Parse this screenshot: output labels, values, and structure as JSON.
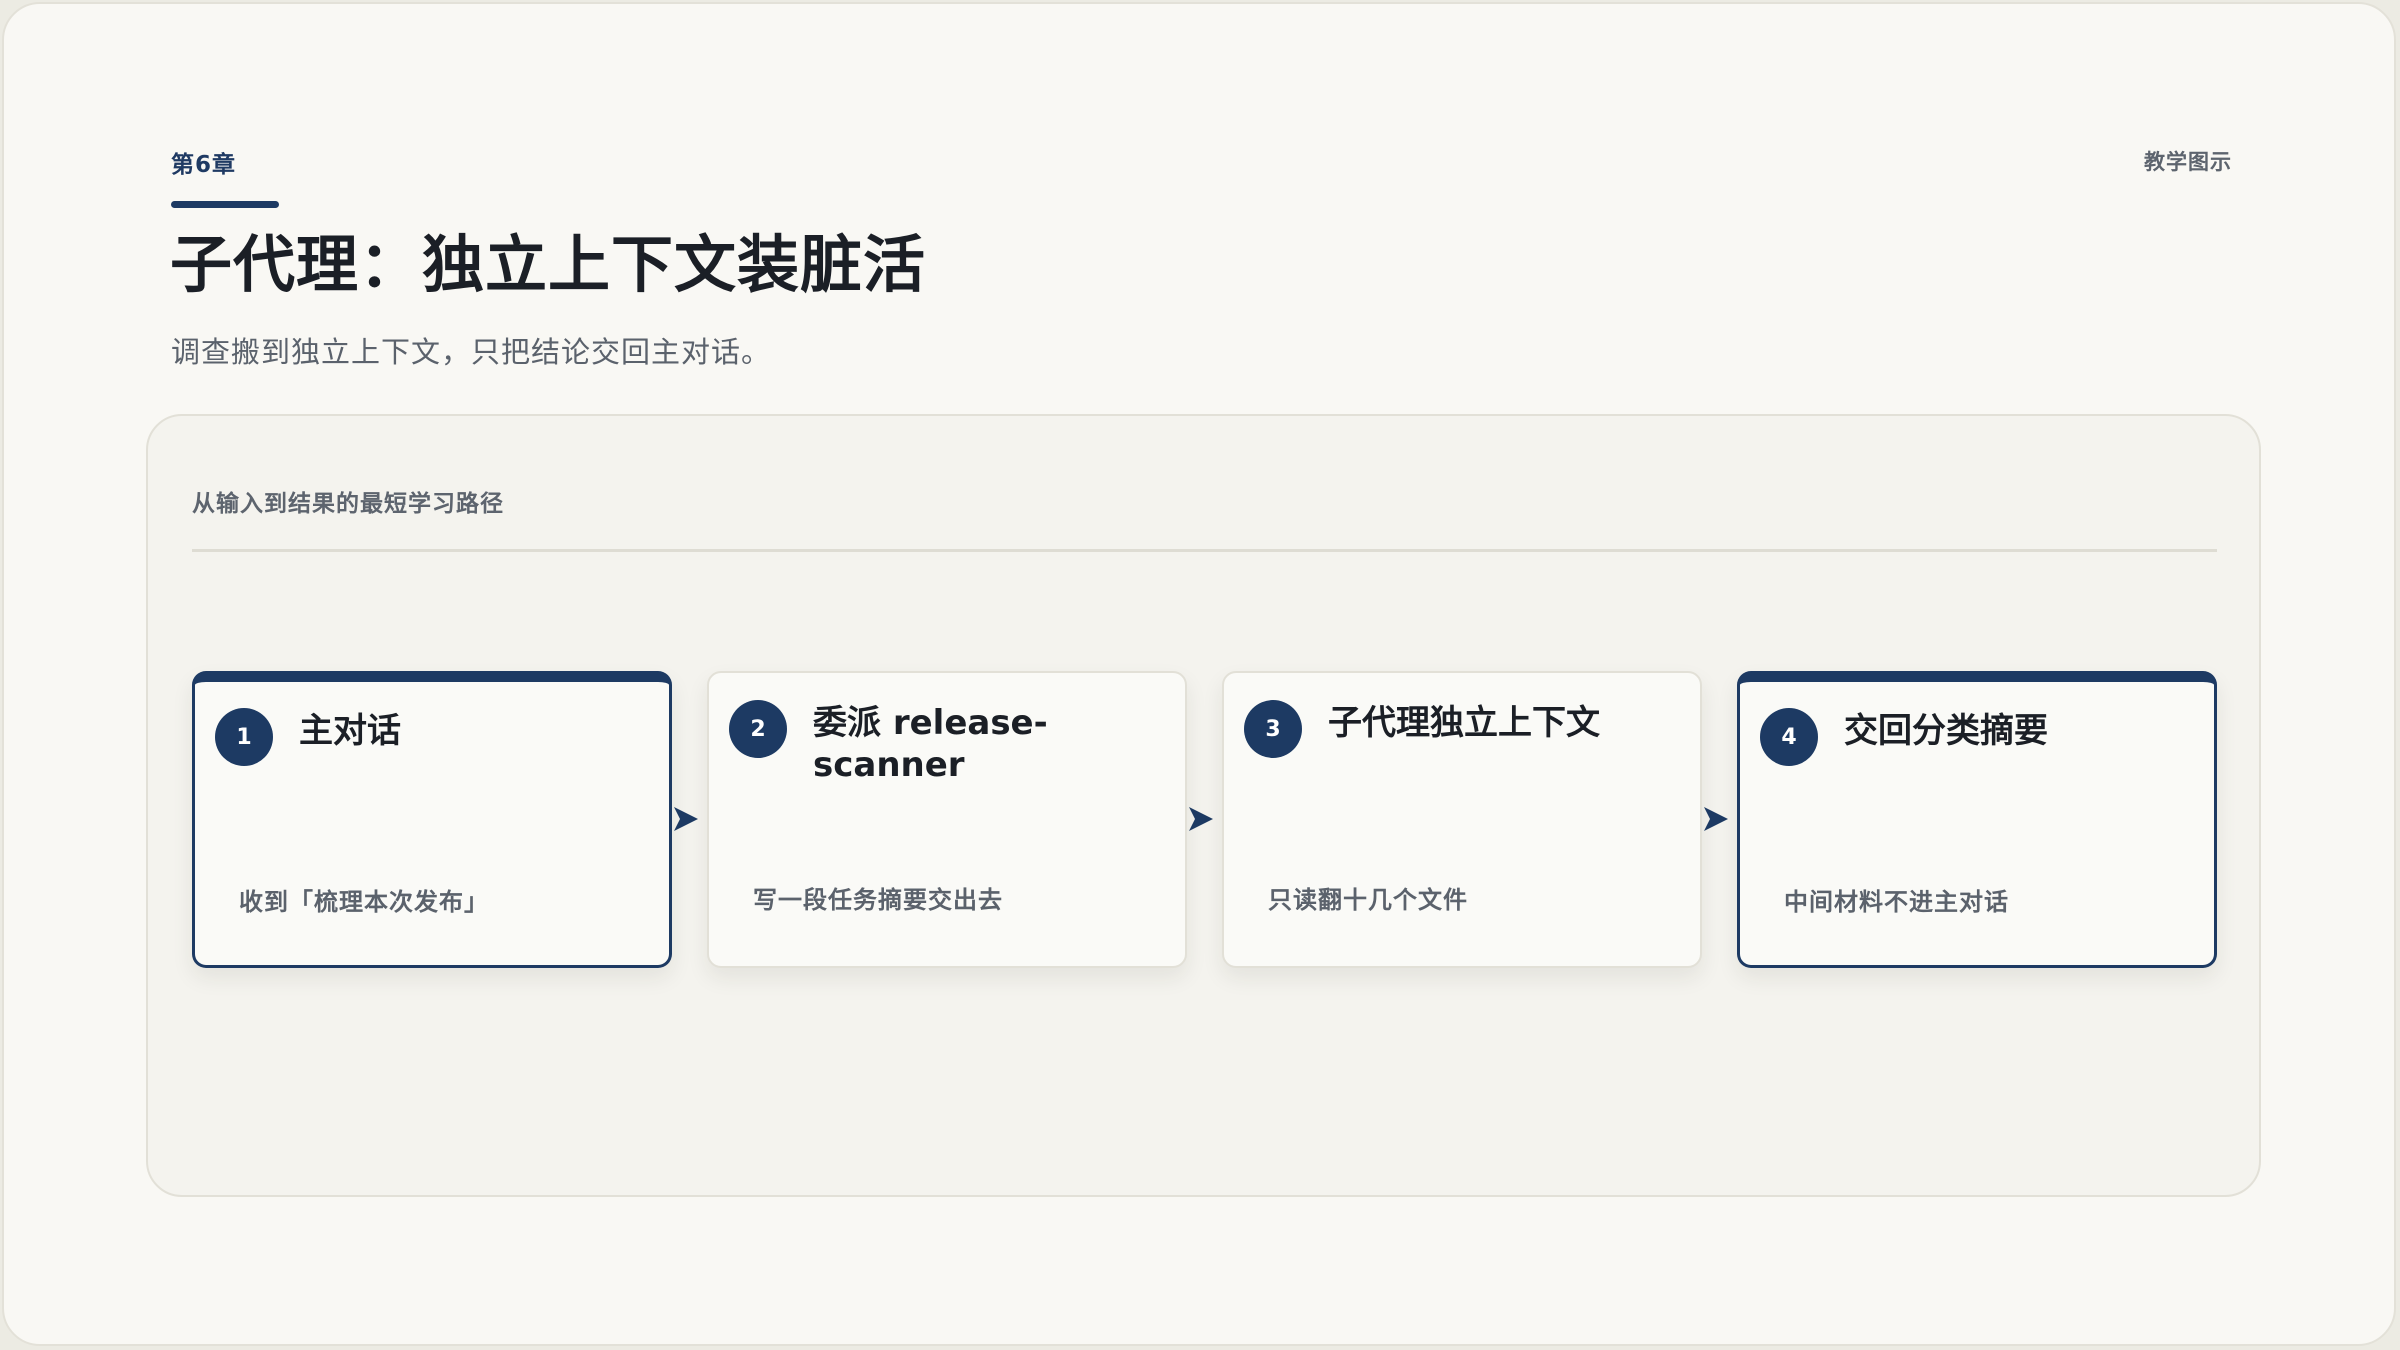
{
  "header": {
    "chapter": "第6章",
    "tag": "教学图示",
    "title": "子代理：独立上下文装脏活",
    "subtitle": "调查搬到独立上下文，只把结论交回主对话。"
  },
  "panel": {
    "label": "从输入到结果的最短学习路径"
  },
  "steps": [
    {
      "number": "1",
      "title": "主对话",
      "description": "收到「梳理本次发布」"
    },
    {
      "number": "2",
      "title": "委派 release-scanner",
      "description": "写一段任务摘要交出去"
    },
    {
      "number": "3",
      "title": "子代理独立上下文",
      "description": "只读翻十几个文件"
    },
    {
      "number": "4",
      "title": "交回分类摘要",
      "description": "中间材料不进主对话"
    }
  ],
  "colors": {
    "accent": "#1d3a63",
    "background": "#f9f8f4",
    "panel": "#f4f3ee",
    "muted_text": "#5b626c"
  },
  "icons": {
    "connector": "arrow-right-icon"
  }
}
